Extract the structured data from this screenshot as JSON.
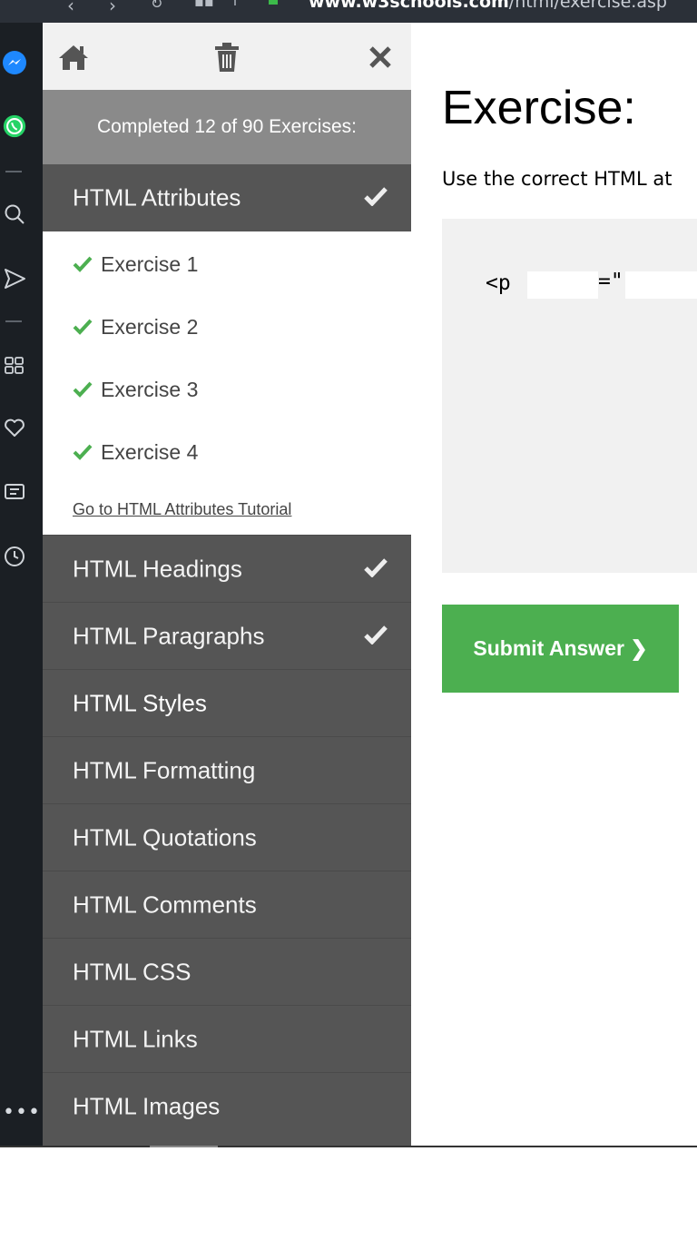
{
  "browser": {
    "url_host": "www.w3schools.com",
    "url_path": "/html/exercise.asp"
  },
  "rail": {
    "icons": [
      "messenger-icon",
      "whatsapp-icon",
      "search-icon",
      "send-icon",
      "apps-grid-icon",
      "heart-icon",
      "news-icon",
      "history-icon",
      "more-icon"
    ],
    "more_label": "•••"
  },
  "menu": {
    "toolbar": {
      "home": "home-icon",
      "trash": "trash-icon",
      "close": "close-icon"
    },
    "completed_text": "Completed 12 of 90 Exercises:",
    "open_chapter": {
      "title": "HTML Attributes",
      "completed": true,
      "exercises": [
        {
          "label": "Exercise 1",
          "done": true
        },
        {
          "label": "Exercise 2",
          "done": true
        },
        {
          "label": "Exercise 3",
          "done": true
        },
        {
          "label": "Exercise 4",
          "done": true
        }
      ],
      "tutorial_link": "Go to HTML Attributes Tutorial"
    },
    "chapters": [
      {
        "title": "HTML Headings",
        "completed": true
      },
      {
        "title": "HTML Paragraphs",
        "completed": true
      },
      {
        "title": "HTML Styles",
        "completed": false
      },
      {
        "title": "HTML Formatting",
        "completed": false
      },
      {
        "title": "HTML Quotations",
        "completed": false
      },
      {
        "title": "HTML Comments",
        "completed": false
      },
      {
        "title": "HTML CSS",
        "completed": false
      },
      {
        "title": "HTML Links",
        "completed": false
      },
      {
        "title": "HTML Images",
        "completed": false
      }
    ]
  },
  "main": {
    "title": "Exercise:",
    "instruction": "Use the correct HTML at",
    "code": {
      "open_tag": "<p",
      "equals": "=\""
    },
    "submit_label": "Submit Answer ❯"
  },
  "colors": {
    "accent_green": "#4caf50",
    "menu_dark": "#555555",
    "completed_bar": "#8a8a8a",
    "rail": "#1b1f24"
  }
}
